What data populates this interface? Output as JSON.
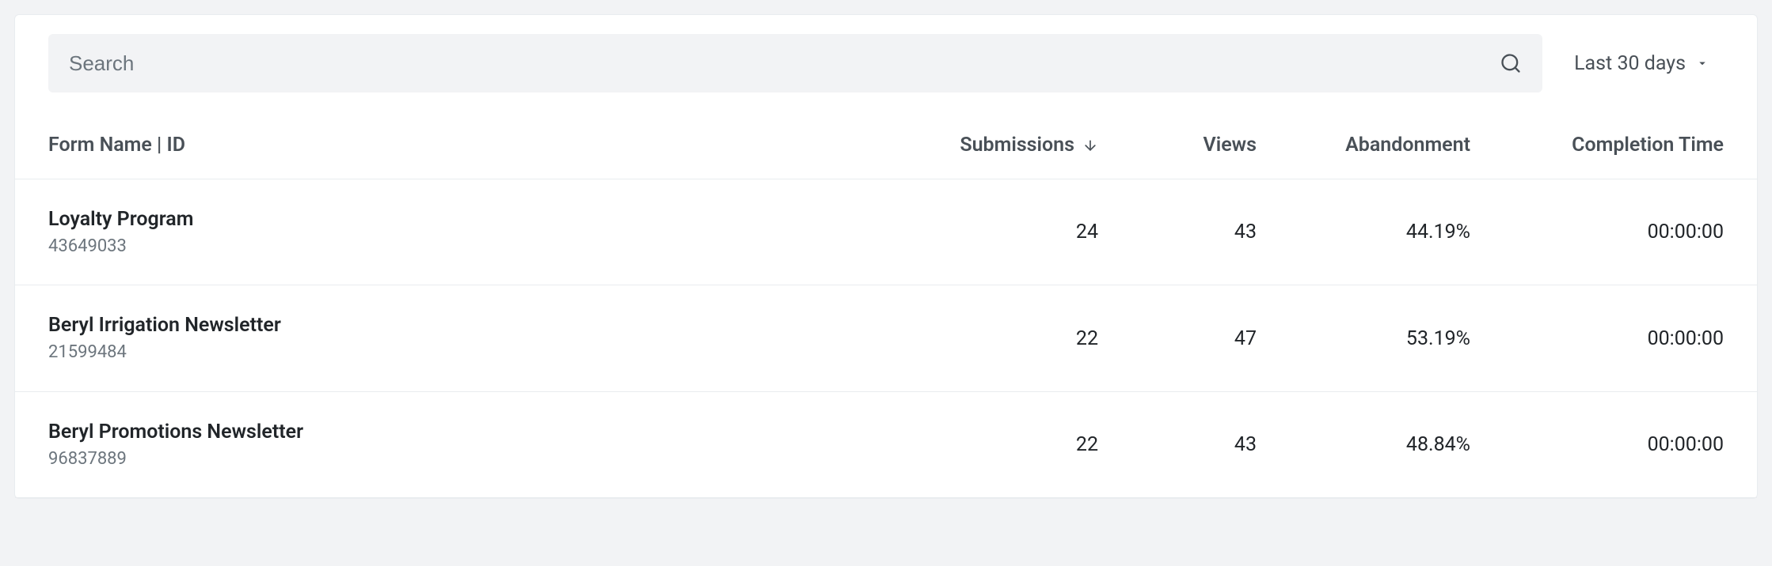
{
  "search": {
    "placeholder": "Search",
    "value": ""
  },
  "dateFilter": {
    "label": "Last 30 days"
  },
  "columns": {
    "name": "Form Name | ID",
    "submissions": "Submissions",
    "views": "Views",
    "abandonment": "Abandonment",
    "completion": "Completion Time"
  },
  "rows": [
    {
      "name": "Loyalty Program",
      "id": "43649033",
      "submissions": "24",
      "views": "43",
      "abandonment": "44.19%",
      "completion": "00:00:00"
    },
    {
      "name": "Beryl Irrigation Newsletter",
      "id": "21599484",
      "submissions": "22",
      "views": "47",
      "abandonment": "53.19%",
      "completion": "00:00:00"
    },
    {
      "name": "Beryl Promotions Newsletter",
      "id": "96837889",
      "submissions": "22",
      "views": "43",
      "abandonment": "48.84%",
      "completion": "00:00:00"
    }
  ]
}
